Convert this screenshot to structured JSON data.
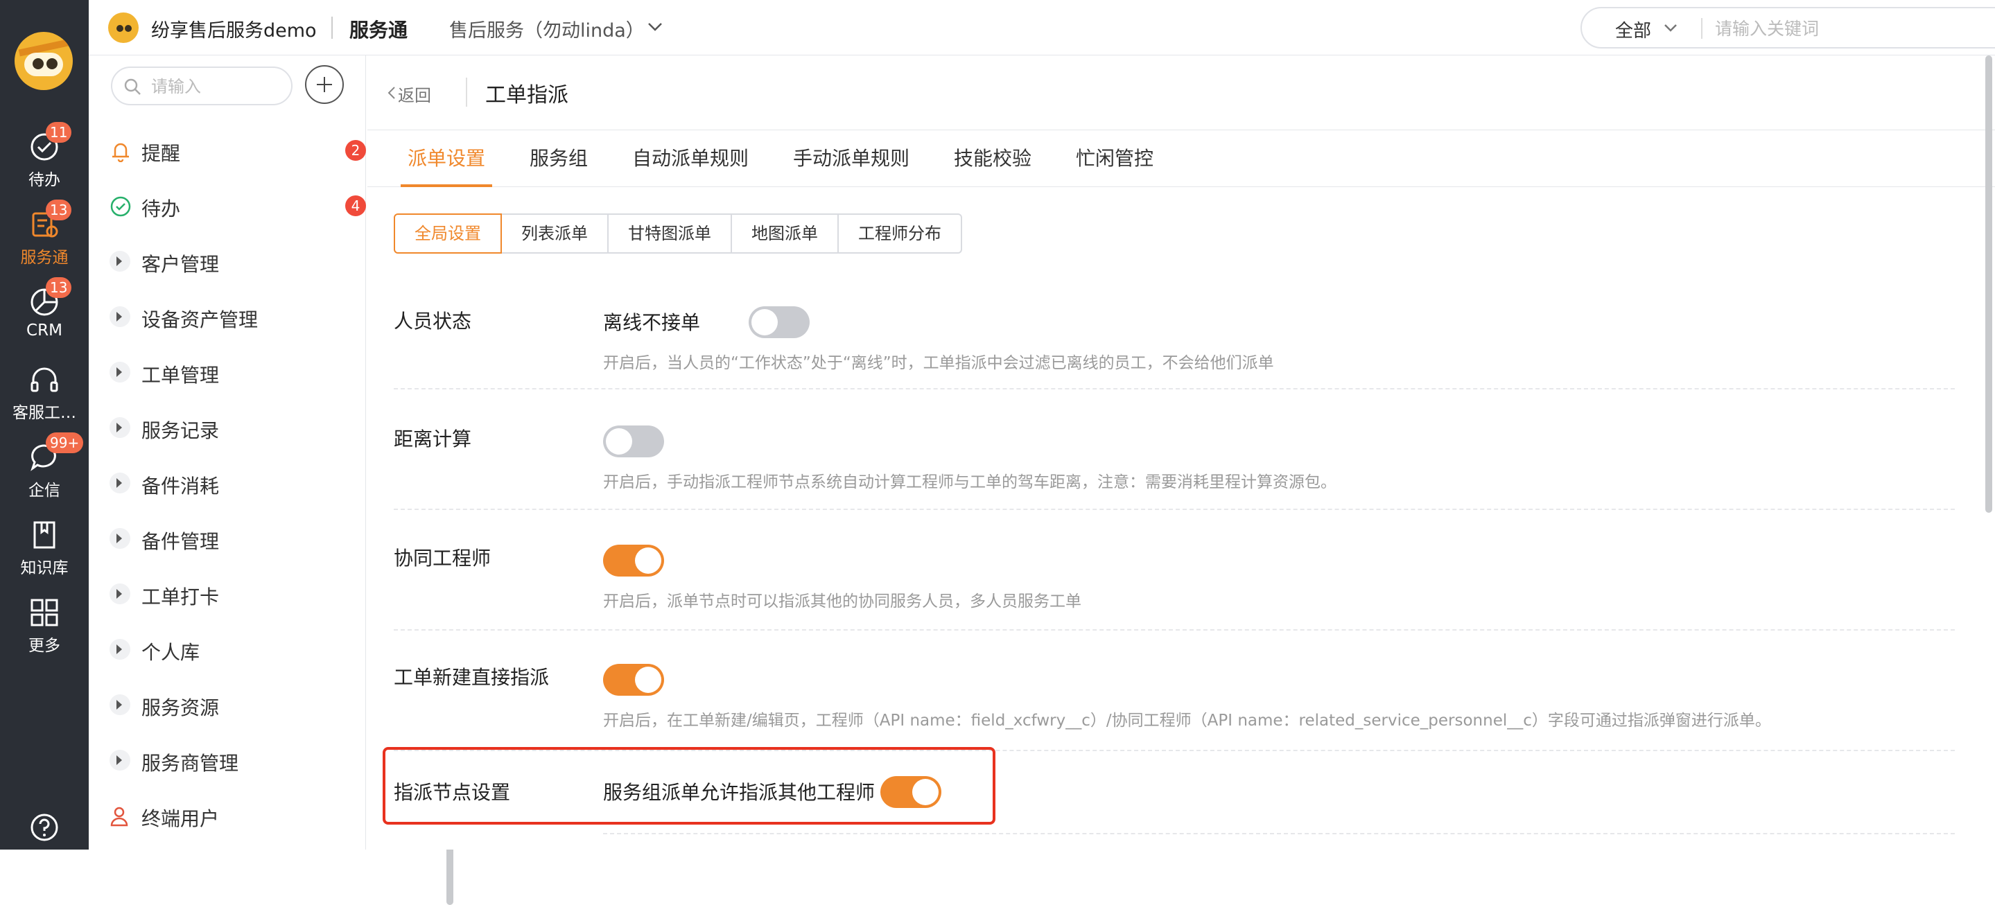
{
  "rail": {
    "items": [
      {
        "label": "待办",
        "badge": "11",
        "icon": "todo-check-icon"
      },
      {
        "label": "服务通",
        "badge": "13",
        "icon": "service-clipboard-icon",
        "active": true
      },
      {
        "label": "CRM",
        "badge": "13",
        "icon": "crm-pie-icon"
      },
      {
        "label": "客服工…",
        "badge": "",
        "icon": "headset-icon"
      },
      {
        "label": "企信",
        "badge": "99+",
        "icon": "chat-bubble-icon"
      },
      {
        "label": "知识库",
        "badge": "",
        "icon": "book-icon"
      },
      {
        "label": "更多",
        "badge": "",
        "icon": "grid-icon"
      }
    ],
    "help_icon": "help-circle-icon"
  },
  "topbar": {
    "company": "纷享售后服务demo",
    "module": "服务通",
    "space": "售后服务（勿动linda）",
    "search_scope": "全部",
    "search_placeholder": "请输入关键词"
  },
  "sidenav": {
    "search_placeholder": "请输入",
    "items": [
      {
        "label": "提醒",
        "badge": "2",
        "icon": "bell-icon"
      },
      {
        "label": "待办",
        "badge": "4",
        "icon": "check-circle-icon"
      },
      {
        "label": "客户管理"
      },
      {
        "label": "设备资产管理"
      },
      {
        "label": "工单管理"
      },
      {
        "label": "服务记录"
      },
      {
        "label": "备件消耗"
      },
      {
        "label": "备件管理"
      },
      {
        "label": "工单打卡"
      },
      {
        "label": "个人库"
      },
      {
        "label": "服务资源"
      },
      {
        "label": "服务商管理"
      },
      {
        "label": "终端用户",
        "icon": "user-icon"
      }
    ]
  },
  "breadcrumb": {
    "back": "返回",
    "title": "工单指派"
  },
  "tabs": [
    "派单设置",
    "服务组",
    "自动派单规则",
    "手动派单规则",
    "技能校验",
    "忙闲管控"
  ],
  "subtabs": [
    "全局设置",
    "列表派单",
    "甘特图派单",
    "地图派单",
    "工程师分布"
  ],
  "settings": [
    {
      "label": "人员状态",
      "inline": "离线不接单",
      "on": false,
      "desc": "开启后，当人员的“工作状态”处于“离线”时，工单指派中会过滤已离线的员工，不会给他们派单"
    },
    {
      "label": "距离计算",
      "inline": "",
      "on": false,
      "desc": "开启后，手动指派工程师节点系统自动计算工程师与工单的驾车距离，注意：需要消耗里程计算资源包。"
    },
    {
      "label": "协同工程师",
      "inline": "",
      "on": true,
      "desc": "开启后，派单节点时可以指派其他的协同服务人员，多人员服务工单"
    },
    {
      "label": "工单新建直接指派",
      "inline": "",
      "on": true,
      "desc": "开启后，在工单新建/编辑页，工程师（API name：field_xcfwry__c）/协同工程师（API name：related_service_personnel__c）字段可通过指派弹窗进行派单。"
    },
    {
      "label": "指派节点设置",
      "inline": "服务组派单允许指派其他工程师",
      "on": true,
      "desc": ""
    }
  ],
  "colors": {
    "accent": "#f0882c",
    "rail_bg": "#2b2f36",
    "badge": "#f26b4a",
    "highlight": "#e8321f"
  }
}
